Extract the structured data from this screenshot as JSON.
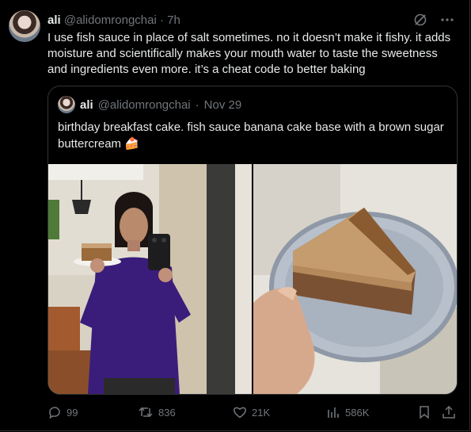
{
  "post": {
    "author_name": "ali",
    "author_handle": "@alidomrongchai",
    "separator": "·",
    "time": "7h",
    "text": "I use fish sauce in place of salt sometimes. no it doesn’t make it fishy. it adds moisture and scientifically makes your mouth water to taste the sweetness and ingredients even more. it’s a cheat code to better baking"
  },
  "quote": {
    "author_name": "ali",
    "author_handle": "@alidomrongchai",
    "separator": "·",
    "date": "Nov 29",
    "text": "birthday breakfast cake. fish sauce banana cake base with a brown sugar buttercream 🍰"
  },
  "actions": {
    "replies": "99",
    "reposts": "836",
    "likes": "21K",
    "views": "586K"
  },
  "colors": {
    "background": "#000000",
    "text": "#e7e9ea",
    "muted": "#71767b",
    "border": "#2f3336"
  },
  "icons": [
    "grok-icon",
    "more-icon",
    "reply-icon",
    "repost-icon",
    "like-icon",
    "views-icon",
    "bookmark-icon",
    "share-icon"
  ]
}
